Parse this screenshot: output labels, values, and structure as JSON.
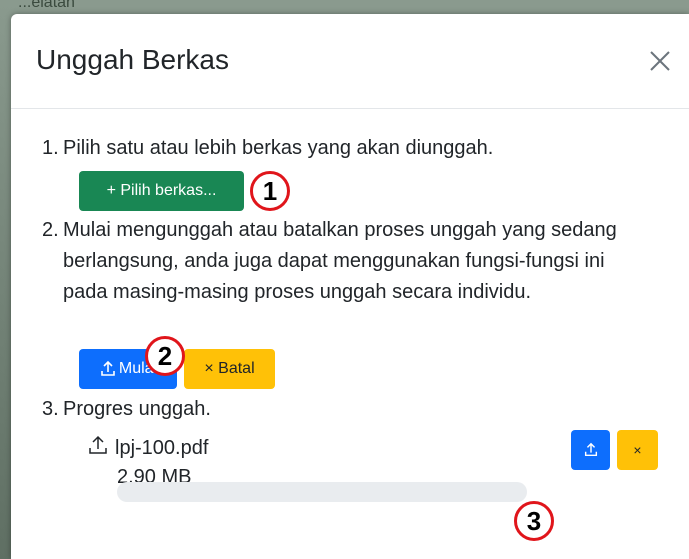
{
  "background": {
    "partial_text": "...elatan"
  },
  "modal": {
    "title": "Unggah Berkas",
    "close_icon": "close-icon"
  },
  "steps": [
    {
      "number": "1.",
      "text": "Pilih satu atau lebih berkas yang akan diunggah."
    },
    {
      "number": "2.",
      "text": "Mulai mengunggah atau batalkan proses unggah yang sedang berlangsung, anda juga dapat menggunakan fungsi-fungsi ini pada masing-masing proses unggah secara individu."
    },
    {
      "number": "3.",
      "text": "Progres unggah."
    }
  ],
  "buttons": {
    "choose_files": "+ Pilih berkas...",
    "start": "Mulai",
    "cancel": "× Batal",
    "file_cancel": "×"
  },
  "file": {
    "name": "lpj-100.pdf",
    "size": "2.90 MB",
    "progress_percent": 0
  },
  "markers": [
    "1",
    "2",
    "3"
  ],
  "colors": {
    "success": "#198754",
    "primary": "#0d6efd",
    "warning": "#ffc107",
    "marker_border": "#e0151b"
  }
}
